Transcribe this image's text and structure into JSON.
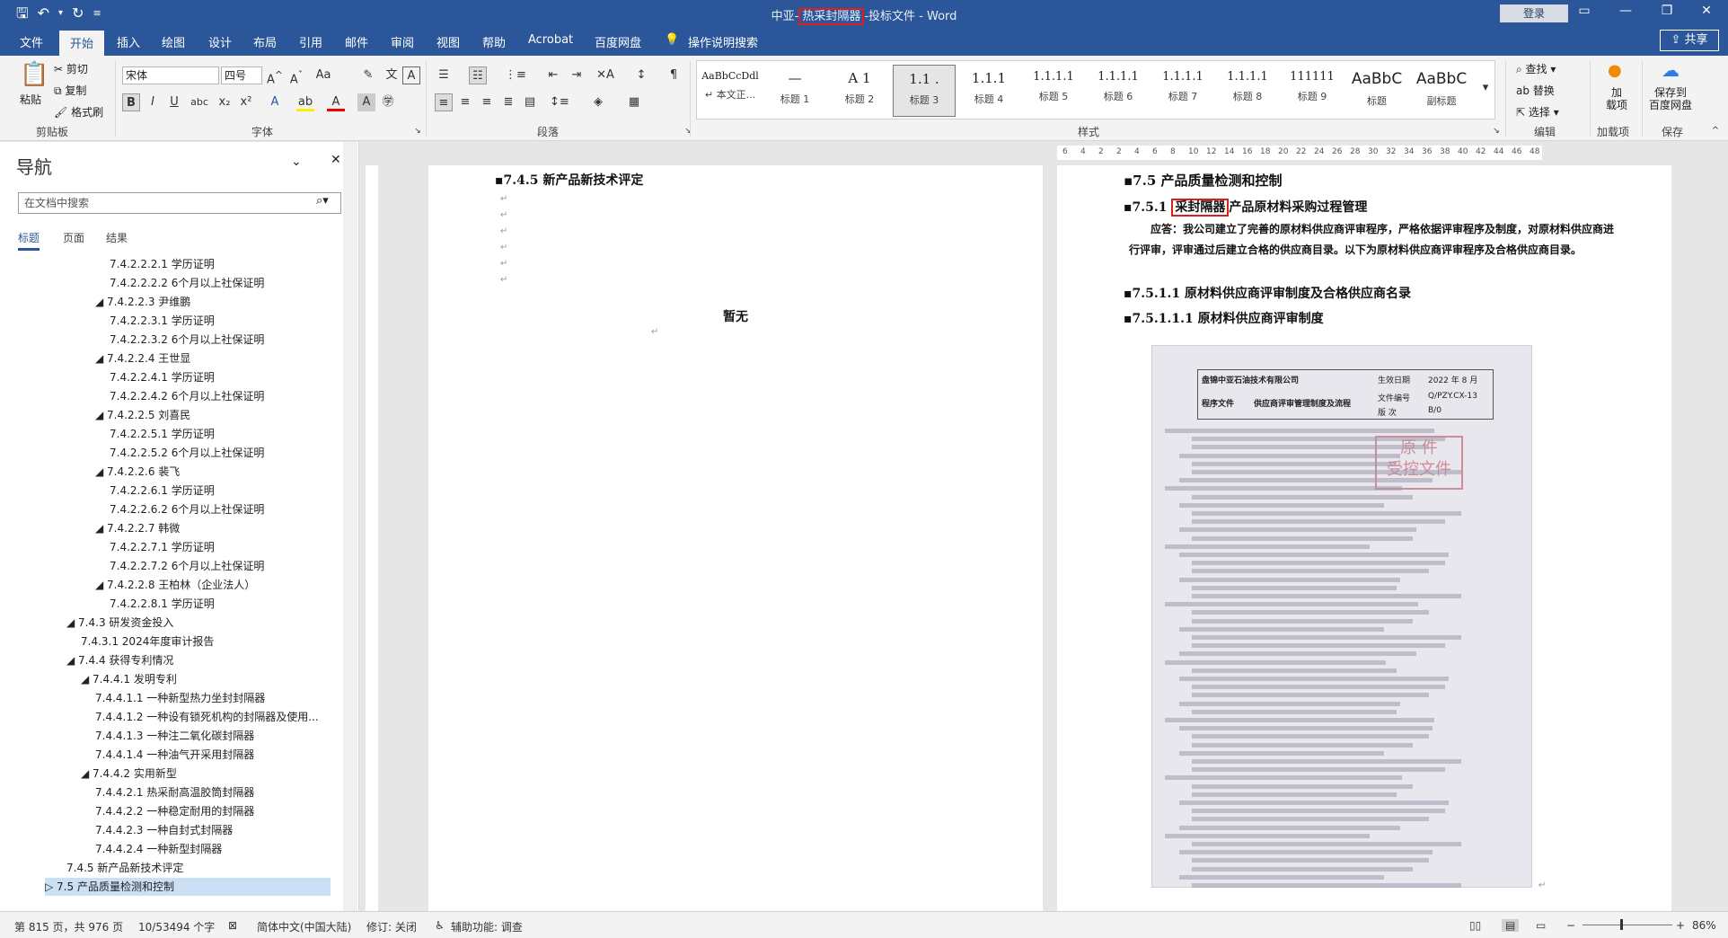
{
  "titlebar": {
    "title_pre": "中亚-",
    "title_hl": "热采封隔器",
    "title_post": "-投标文件  -  Word",
    "login": "登录",
    "qat": [
      "save-icon",
      "undo-icon",
      "redo-icon",
      "customize-icon"
    ]
  },
  "tabs": [
    "文件",
    "开始",
    "插入",
    "绘图",
    "设计",
    "布局",
    "引用",
    "邮件",
    "审阅",
    "视图",
    "帮助",
    "Acrobat",
    "百度网盘",
    "操作说明搜索"
  ],
  "share": "共享",
  "ribbon": {
    "clipboard": {
      "paste": "粘贴",
      "cut": "剪切",
      "copy": "复制",
      "format_painter": "格式刷",
      "label": "剪贴板"
    },
    "font": {
      "name": "宋体",
      "size": "四号",
      "label": "字体"
    },
    "paragraph": {
      "label": "段落"
    },
    "styles": {
      "label": "样式",
      "items": [
        {
          "sample": "AaBbCcDdl",
          "name": "↵ 本文正..."
        },
        {
          "sample": "—",
          "name": "标题 1"
        },
        {
          "sample": "A 1",
          "name": "标题 2"
        },
        {
          "sample": "1.1 .",
          "name": "标题 3"
        },
        {
          "sample": "1.1.1",
          "name": "标题 4"
        },
        {
          "sample": "1.1.1.1",
          "name": "标题 5"
        },
        {
          "sample": "1.1.1.1",
          "name": "标题 6"
        },
        {
          "sample": "1.1.1.1",
          "name": "标题 7"
        },
        {
          "sample": "1.1.1.1",
          "name": "标题 8"
        },
        {
          "sample": "111111",
          "name": "标题 9"
        },
        {
          "sample": "AaBbC",
          "name": "标题"
        },
        {
          "sample": "AaBbC",
          "name": "副标题"
        }
      ],
      "selected": 3
    },
    "editing": {
      "find": "查找",
      "replace": "替换",
      "select": "选择",
      "label": "编辑"
    },
    "addins": {
      "name": "加\n载项",
      "label": "加载项"
    },
    "save": {
      "name": "保存到\n百度网盘",
      "label": "保存"
    }
  },
  "nav": {
    "title": "导航",
    "search_placeholder": "在文档中搜索",
    "tabs": [
      "标题",
      "页面",
      "结果"
    ],
    "items": [
      {
        "text": "7.4.2.2.2.1 学历证明",
        "indent": 3
      },
      {
        "text": "7.4.2.2.2.2 6个月以上社保证明",
        "indent": 3
      },
      {
        "text": "◢ 7.4.2.2.3 尹维鹏",
        "indent": 2
      },
      {
        "text": "7.4.2.2.3.1 学历证明",
        "indent": 3
      },
      {
        "text": "7.4.2.2.3.2 6个月以上社保证明",
        "indent": 3
      },
      {
        "text": "◢ 7.4.2.2.4 王世显",
        "indent": 2
      },
      {
        "text": "7.4.2.2.4.1 学历证明",
        "indent": 3
      },
      {
        "text": "7.4.2.2.4.2 6个月以上社保证明",
        "indent": 3
      },
      {
        "text": "◢ 7.4.2.2.5 刘喜民",
        "indent": 2
      },
      {
        "text": "7.4.2.2.5.1 学历证明",
        "indent": 3
      },
      {
        "text": "7.4.2.2.5.2 6个月以上社保证明",
        "indent": 3
      },
      {
        "text": "◢ 7.4.2.2.6 裴飞",
        "indent": 2
      },
      {
        "text": "7.4.2.2.6.1 学历证明",
        "indent": 3
      },
      {
        "text": "7.4.2.2.6.2 6个月以上社保证明",
        "indent": 3
      },
      {
        "text": "◢ 7.4.2.2.7 韩微",
        "indent": 2
      },
      {
        "text": "7.4.2.2.7.1 学历证明",
        "indent": 3
      },
      {
        "text": "7.4.2.2.7.2 6个月以上社保证明",
        "indent": 3
      },
      {
        "text": "◢ 7.4.2.2.8 王柏林（企业法人）",
        "indent": 2
      },
      {
        "text": "7.4.2.2.8.1 学历证明",
        "indent": 3
      },
      {
        "text": "◢ 7.4.3 研发资金投入",
        "indent": 0
      },
      {
        "text": "7.4.3.1 2024年度审计报告",
        "indent": 1
      },
      {
        "text": "◢ 7.4.4 获得专利情况",
        "indent": 0
      },
      {
        "text": "◢ 7.4.4.1 发明专利",
        "indent": 1
      },
      {
        "text": "7.4.4.1.1 一种新型热力坐封封隔器",
        "indent": 2
      },
      {
        "text": "7.4.4.1.2 一种设有锁死机构的封隔器及使用...",
        "indent": 2
      },
      {
        "text": "7.4.4.1.3 一种注二氧化碳封隔器",
        "indent": 2
      },
      {
        "text": "7.4.4.1.4 一种油气开采用封隔器",
        "indent": 2
      },
      {
        "text": "◢ 7.4.4.2 实用新型",
        "indent": 1
      },
      {
        "text": "7.4.4.2.1 热采耐高温胶筒封隔器",
        "indent": 2
      },
      {
        "text": "7.4.4.2.2 一种稳定耐用的封隔器",
        "indent": 2
      },
      {
        "text": "7.4.4.2.3 一种自封式封隔器",
        "indent": 2
      },
      {
        "text": "7.4.4.2.4 一种新型封隔器",
        "indent": 2
      },
      {
        "text": "7.4.5 新产品新技术评定",
        "indent": 0
      },
      {
        "text": "▷ 7.5 产品质量检测和控制",
        "indent": -1,
        "selected": true
      }
    ]
  },
  "ruler_ticks": [
    "6",
    "4",
    "2",
    "2",
    "4",
    "6",
    "8",
    "10",
    "12",
    "14",
    "16",
    "18",
    "20",
    "22",
    "24",
    "26",
    "28",
    "30",
    "32",
    "34",
    "36",
    "38",
    "40",
    "42",
    "44",
    "46",
    "48"
  ],
  "page_left": {
    "heading": "7.4.5 新产品新技术评定",
    "content": "暂无"
  },
  "page_right": {
    "h1": "7.5 产品质量检测和控制",
    "h2_pre": "7.5.1 ",
    "h2_hl": "采封隔器",
    "h2_post": "产品原材料采购过程管理",
    "answer": "应答：我公司建立了完善的原材料供应商评审程序，严格依据评审程序及制度，对原材料供应商进行评审，评审通过后建立合格的供应商目录。以下为原材料供应商评审程序及合格供应商目录。",
    "h3": "7.5.1.1 原材料供应商评审制度及合格供应商名录",
    "h4": "7.5.1.1.1 原材料供应商评审制度",
    "scan": {
      "company": "盘锦中亚石油技术有限公司",
      "doc_type": "程序文件",
      "doc_title": "供应商评审管理制度及流程",
      "date_label": "生效日期",
      "date": "2022 年 8 月",
      "num_label": "文件编号",
      "num": "Q/PZY.CX-13",
      "ver_label": "版  次",
      "ver": "B/0",
      "stamp": "原 件\n受控文件"
    }
  },
  "status": {
    "page": "第 815 页，共 976 页",
    "words": "10/53494 个字",
    "lang": "简体中文(中国大陆)",
    "revision": "修订: 关闭",
    "accessibility": "辅助功能: 调查",
    "zoom": "86%"
  }
}
